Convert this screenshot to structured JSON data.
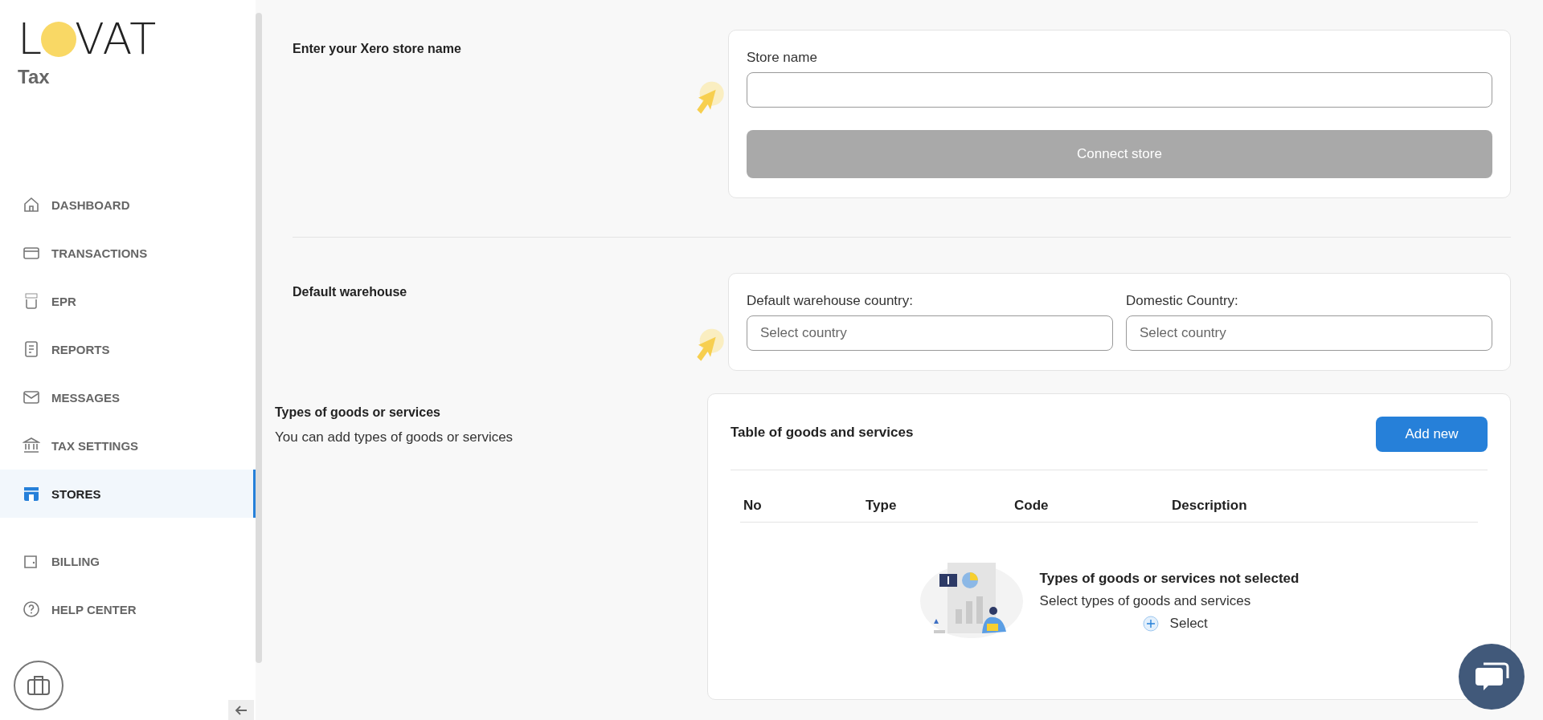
{
  "logo": {
    "left": "L",
    "right": "VAT",
    "subtitle": "Tax"
  },
  "sidebar": {
    "items": [
      {
        "label": "DASHBOARD",
        "selected": false
      },
      {
        "label": "TRANSACTIONS",
        "selected": false
      },
      {
        "label": "EPR",
        "selected": false
      },
      {
        "label": "REPORTS",
        "selected": false
      },
      {
        "label": "MESSAGES",
        "selected": false
      },
      {
        "label": "TAX SETTINGS",
        "selected": false
      },
      {
        "label": "STORES",
        "selected": true
      }
    ],
    "bottom_items": [
      {
        "label": "BILLING",
        "selected": false
      },
      {
        "label": "HELP CENTER",
        "selected": false
      }
    ]
  },
  "store_section": {
    "title": "Enter your Xero store name",
    "field_label": "Store name",
    "button": "Connect store",
    "button_disabled": true
  },
  "warehouse_section": {
    "title": "Default warehouse",
    "fields": [
      {
        "label": "Default warehouse country:",
        "placeholder": "Select country"
      },
      {
        "label": "Domestic Country:",
        "placeholder": "Select country"
      }
    ]
  },
  "goods_section": {
    "title": "Types of goods or services",
    "description": "You can add types of goods or services",
    "table": {
      "title": "Table of goods and services",
      "add_button": "Add new",
      "columns": [
        "No",
        "Type",
        "Code",
        "Description"
      ],
      "empty_title": "Types of goods or services not selected",
      "empty_text": "Select types of goods and services",
      "select_button": "Select"
    }
  }
}
